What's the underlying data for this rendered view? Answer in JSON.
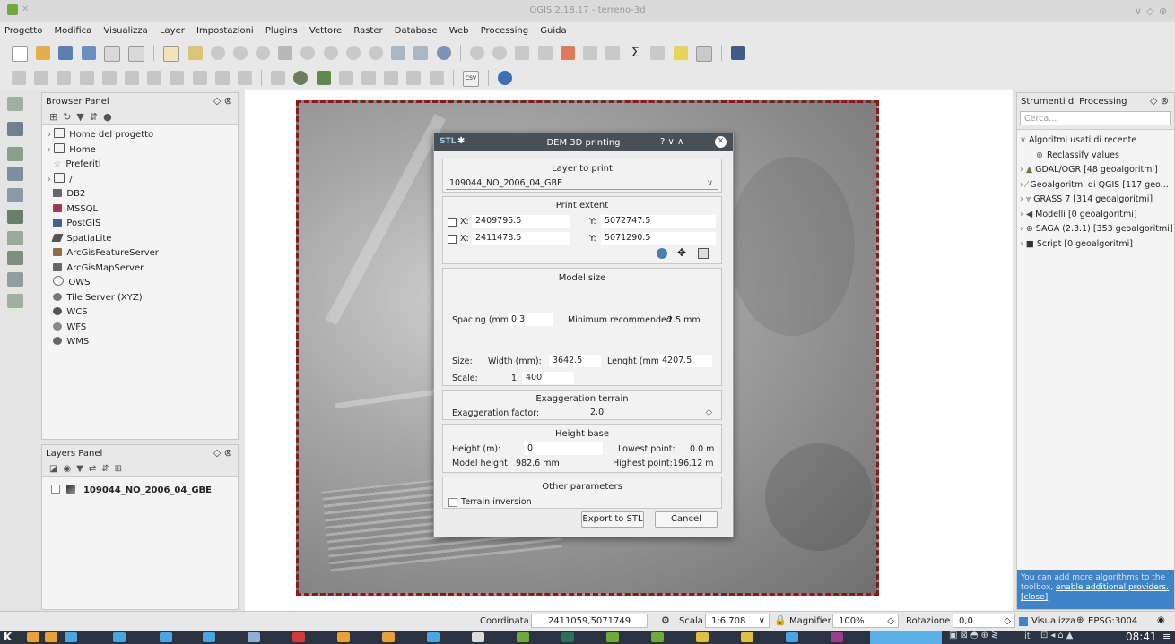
{
  "window": {
    "title": "QGIS 2.18.17 - terreno-3d"
  },
  "menu": [
    "Progetto",
    "Modifica",
    "Visualizza",
    "Layer",
    "Impostazioni",
    "Plugins",
    "Vettore",
    "Raster",
    "Database",
    "Web",
    "Processing",
    "Guida"
  ],
  "browser_panel": {
    "title": "Browser Panel",
    "items": [
      "Home del progetto",
      "Home",
      "Preferiti",
      "/",
      "DB2",
      "MSSQL",
      "PostGIS",
      "SpatiaLite",
      "ArcGisFeatureServer",
      "ArcGisMapServer",
      "OWS",
      "Tile Server (XYZ)",
      "WCS",
      "WFS",
      "WMS"
    ]
  },
  "layers_panel": {
    "title": "Layers Panel",
    "layer": "109044_NO_2006_04_GBE"
  },
  "processing_panel": {
    "title": "Strumenti di Processing",
    "search_placeholder": "Cerca...",
    "items": [
      "Algoritmi usati di recente",
      "Reclassify values",
      "GDAL/OGR [48 geoalgoritmi]",
      "Geoalgoritmi di QGIS [117 geo...",
      "GRASS 7 [314 geoalgoritmi]",
      "Modelli [0 geoalgoritmi]",
      "SAGA (2.3.1) [353 geoalgoritmi]",
      "Script [0 geoalgoritmi]"
    ],
    "notice": "You can add more algorithms to the toolbox,",
    "notice_link": "enable additional providers.",
    "notice_close": "[close]"
  },
  "dialog": {
    "title": "DEM 3D printing",
    "title_controls": "? ∨ ∧",
    "layer_section": "Layer to print",
    "layer_value": "109044_NO_2006_04_GBE",
    "extent_section": "Print extent",
    "x1_label": "X:",
    "x1": "2409795.5",
    "y1_label": "Y:",
    "y1": "5072747.5",
    "x2_label": "X:",
    "x2": "2411478.5",
    "y2_label": "Y:",
    "y2": "5071290.5",
    "model_section": "Model size",
    "spacing_label": "Spacing (mm):",
    "spacing": "0.3",
    "min_label": "Minimum recommended",
    "min_value": "2.5 mm",
    "size_label": "Size:",
    "width_label": "Width (mm):",
    "width": "3642.5",
    "length_label": "Lenght (mm):",
    "length": "4207.5",
    "scale_label": "Scale:",
    "scale_prefix": "1:",
    "scale": "400",
    "exag_section": "Exaggeration terrain",
    "exag_label": "Exaggeration factor:",
    "exag": "2.0",
    "height_section": "Height base",
    "height_label": "Height (m):",
    "height": "0",
    "lowest_label": "Lowest point:",
    "lowest": "0.0 m",
    "model_height_label": "Model height:",
    "model_height": "982.6 mm",
    "highest_label": "Highest point:",
    "highest": "196.12 m",
    "other_section": "Other parameters",
    "terrain_inversion": "Terrain inversion",
    "export_btn": "Export to STL",
    "cancel_btn": "Cancel"
  },
  "status": {
    "coord_label": "Coordinata",
    "coord": "2411059,5071749",
    "scale_label": "Scala",
    "scale": "1:6.708",
    "magnifier_label": "Magnifier",
    "magnifier": "100%",
    "rotation_label": "Rotazione",
    "rotation": "0,0",
    "render_label": "Visualizza",
    "epsg": "EPSG:3004"
  },
  "taskbar": {
    "tray_lang": "it",
    "clock": "08:41"
  },
  "colors": {
    "accent": "#475057",
    "map_border": "#8b1a1a",
    "link": "#ffffff",
    "notice_bg": "#3f84c6"
  }
}
